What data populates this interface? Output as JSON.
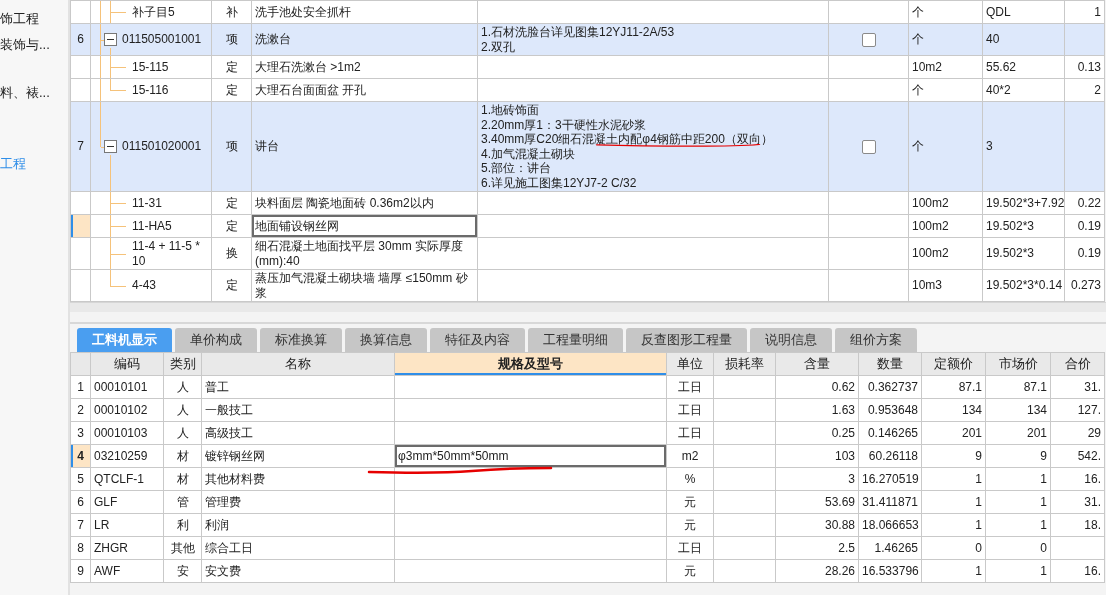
{
  "sidebar": {
    "items": [
      {
        "label": "饰工程",
        "selected": false
      },
      {
        "label": "装饰与...",
        "selected": false
      },
      {
        "label": "料、裱...",
        "selected": false
      },
      {
        "label": "工程",
        "selected": true
      }
    ]
  },
  "bill_table": {
    "rows": [
      {
        "kind": "sub",
        "code": "补子目5",
        "type": "补",
        "name": "洗手池处安全抓杆",
        "unit": "个",
        "quantity": "QDL",
        "column_9": "1",
        "selected": false
      },
      {
        "kind": "item",
        "number": "6",
        "expanded": true,
        "code": "011505001001",
        "type": "项",
        "name": "洗漱台",
        "features": [
          {
            "text": "1.石材洗脸台详见图集12YJ11-2A/53",
            "marked": false
          },
          {
            "text": "2.双孔",
            "marked": false
          }
        ],
        "checked": false,
        "unit": "个",
        "quantity": "40",
        "selected": false,
        "children": [
          {
            "code": "15-115",
            "type": "定",
            "name": "大理石洗漱台 >1m2",
            "unit": "10m2",
            "quantity": "55.62",
            "column_9": "0.13",
            "selected": false
          },
          {
            "code": "15-116",
            "type": "定",
            "name": "大理石台面面盆 开孔",
            "unit": "个",
            "quantity": "40*2",
            "column_9": "2",
            "selected": false
          }
        ]
      },
      {
        "kind": "item",
        "number": "7",
        "expanded": true,
        "code": "011501020001",
        "type": "项",
        "name": "讲台",
        "features": [
          {
            "text": "1.地砖饰面",
            "marked": false
          },
          {
            "text": "2.20mm厚1：3干硬性水泥砂浆",
            "marked": false
          },
          {
            "text": "3.40mm厚C20细石混凝土内配φ4钢筋中距200（双向）",
            "marked": true
          },
          {
            "text": "4.加气混凝土砌块",
            "marked": false
          },
          {
            "text": "5.部位：讲台",
            "marked": false
          },
          {
            "text": "6.详见施工图集12YJ7-2 C/32",
            "marked": false
          }
        ],
        "checked": false,
        "unit": "个",
        "quantity": "3",
        "selected": false,
        "children": [
          {
            "code": "11-31",
            "type": "定",
            "name": "块料面层 陶瓷地面砖 0.36m2以内",
            "unit": "100m2",
            "quantity": "19.502*3+7.92",
            "column_9": "0.22",
            "selected": false
          },
          {
            "code": "11-HA5",
            "type": "定",
            "name": "地面铺设钢丝网",
            "unit": "100m2",
            "quantity": "19.502*3",
            "column_9": "0.19",
            "selected": true
          },
          {
            "code": "11-4 + 11-5 * 10",
            "type": "换",
            "name": "细石混凝土地面找平层 30mm  实际厚度(mm):40",
            "unit": "100m2",
            "quantity": "19.502*3",
            "column_9": "0.19",
            "selected": false
          },
          {
            "code": "4-43",
            "type": "定",
            "name": "蒸压加气混凝土砌块墙 墙厚 ≤150mm 砂浆",
            "unit": "10m3",
            "quantity": "19.502*3*0.14",
            "column_9": "0.273",
            "selected": false
          }
        ]
      }
    ]
  },
  "tabs": [
    {
      "label": "工料机显示",
      "selected": true
    },
    {
      "label": "单价构成",
      "selected": false
    },
    {
      "label": "标准换算",
      "selected": false
    },
    {
      "label": "换算信息",
      "selected": false
    },
    {
      "label": "特征及内容",
      "selected": false
    },
    {
      "label": "工程量明细",
      "selected": false
    },
    {
      "label": "反查图形工程量",
      "selected": false
    },
    {
      "label": "说明信息",
      "selected": false
    },
    {
      "label": "组价方案",
      "selected": false
    }
  ],
  "resource_table": {
    "columns": [
      {
        "label": "编码",
        "selected": false
      },
      {
        "label": "类别",
        "selected": false
      },
      {
        "label": "名称",
        "selected": false
      },
      {
        "label": "规格及型号",
        "selected": true
      },
      {
        "label": "单位",
        "selected": false
      },
      {
        "label": "损耗率",
        "selected": false
      },
      {
        "label": "含量",
        "selected": false
      },
      {
        "label": "数量",
        "selected": false
      },
      {
        "label": "定额价",
        "selected": false
      },
      {
        "label": "市场价",
        "selected": false
      },
      {
        "label": "合价",
        "selected": false
      }
    ],
    "rows": [
      {
        "number": "1",
        "code": "00010101",
        "type": "人",
        "name": "普工",
        "unit": "工日",
        "content": "0.62",
        "quantity": "0.362737",
        "quota_price": "87.1",
        "market_price": "87.1",
        "total": "31.",
        "selected": false
      },
      {
        "number": "2",
        "code": "00010102",
        "type": "人",
        "name": "一般技工",
        "unit": "工日",
        "content": "1.63",
        "quantity": "0.953648",
        "quota_price": "134",
        "market_price": "134",
        "total": "127.",
        "selected": false
      },
      {
        "number": "3",
        "code": "00010103",
        "type": "人",
        "name": "高级技工",
        "unit": "工日",
        "content": "0.25",
        "quantity": "0.146265",
        "quota_price": "201",
        "market_price": "201",
        "total": "29",
        "selected": false
      },
      {
        "number": "4",
        "code": "03210259",
        "type": "材",
        "name": "镀锌钢丝网",
        "spec": "φ3mm*50mm*50mm",
        "marked": true,
        "unit": "m2",
        "content": "103",
        "quantity": "60.26118",
        "quota_price": "9",
        "market_price": "9",
        "total": "542.",
        "selected": true
      },
      {
        "number": "5",
        "code": "QTCLF-1",
        "type": "材",
        "name": "其他材料费",
        "unit": "%",
        "content": "3",
        "quantity": "16.270519",
        "quota_price": "1",
        "market_price": "1",
        "total": "16.",
        "selected": false
      },
      {
        "number": "6",
        "code": "GLF",
        "type": "管",
        "name": "管理费",
        "unit": "元",
        "content": "53.69",
        "quantity": "31.411871",
        "quota_price": "1",
        "market_price": "1",
        "total": "31.",
        "selected": false
      },
      {
        "number": "7",
        "code": "LR",
        "type": "利",
        "name": "利润",
        "unit": "元",
        "content": "30.88",
        "quantity": "18.066653",
        "quota_price": "1",
        "market_price": "1",
        "total": "18.",
        "selected": false
      },
      {
        "number": "8",
        "code": "ZHGR",
        "type": "其他",
        "name": "综合工日",
        "unit": "工日",
        "content": "2.5",
        "quantity": "1.46265",
        "quota_price": "0",
        "market_price": "0",
        "selected": false
      },
      {
        "number": "9",
        "code": "AWF",
        "type": "安",
        "name": "安文费",
        "unit": "元",
        "content": "28.26",
        "quantity": "16.533796",
        "quota_price": "1",
        "market_price": "1",
        "total": "16.",
        "selected": false
      }
    ]
  }
}
